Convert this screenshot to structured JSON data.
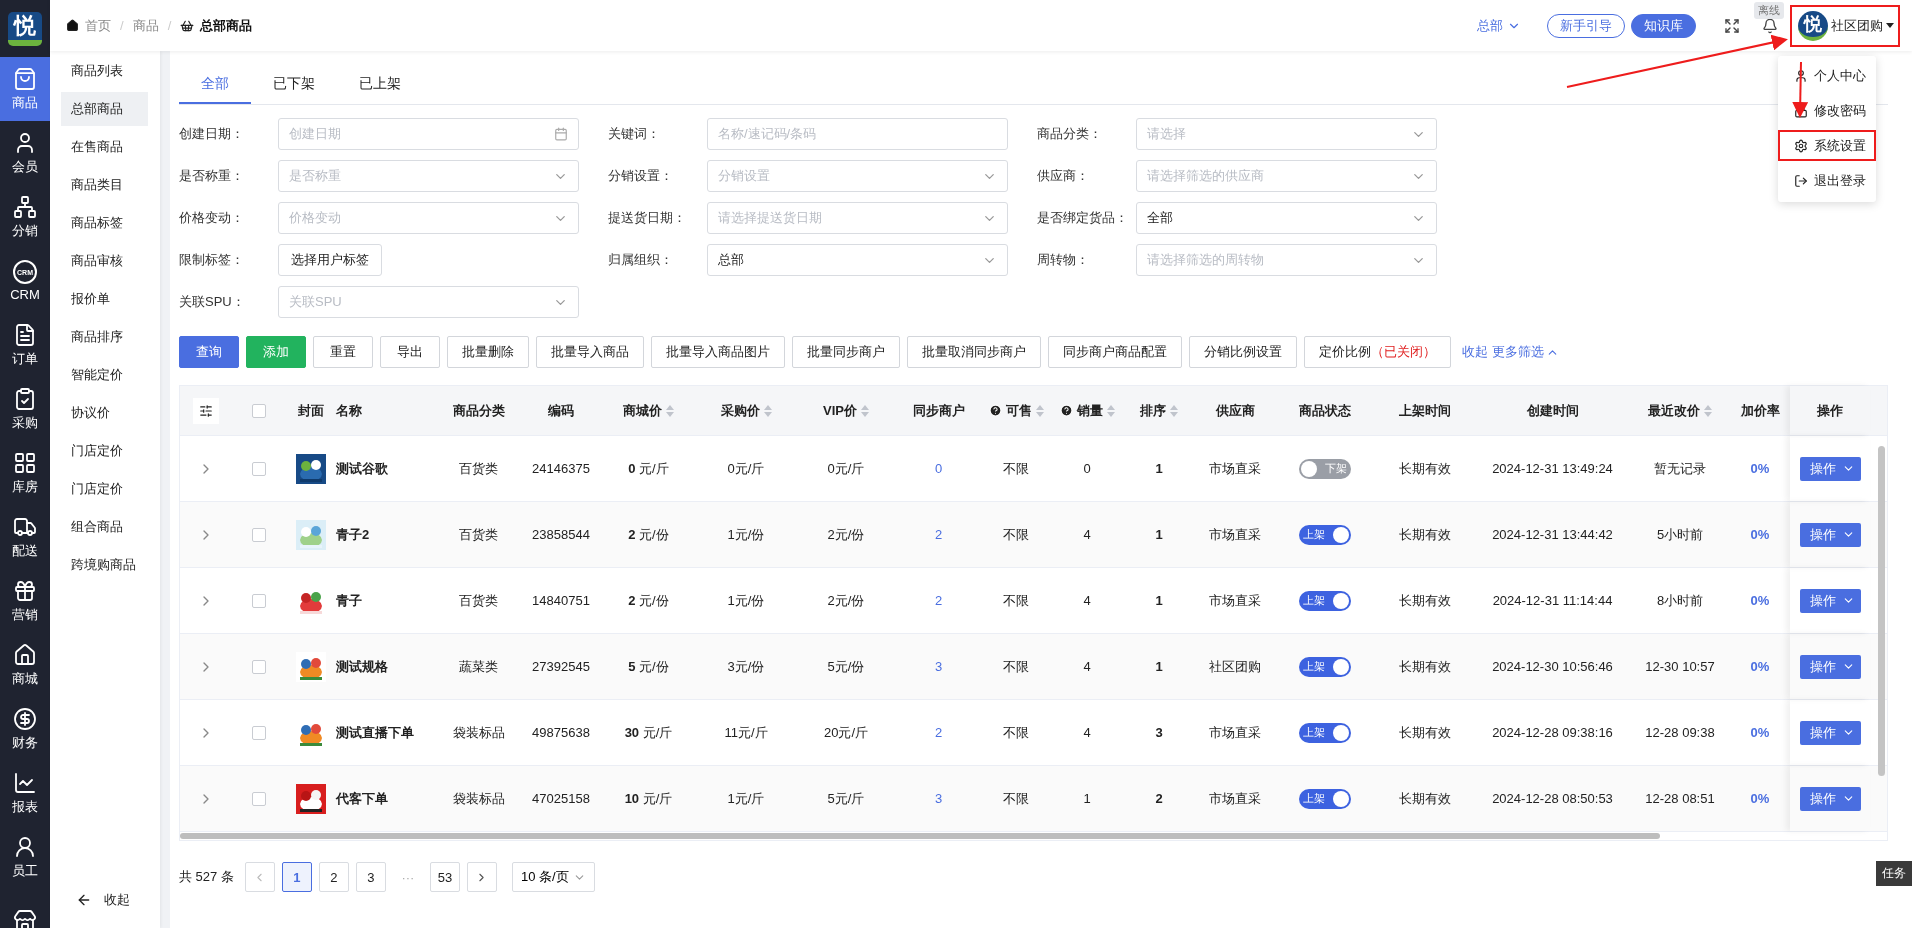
{
  "sidebar": {
    "logo": "悦",
    "items": [
      {
        "label": "商品",
        "selected": true
      },
      {
        "label": "会员",
        "selected": false
      },
      {
        "label": "分销",
        "selected": false
      },
      {
        "label": "CRM",
        "icon_text": "CRM",
        "selected": false
      },
      {
        "label": "订单",
        "selected": false
      },
      {
        "label": "采购",
        "selected": false
      },
      {
        "label": "库房",
        "selected": false
      },
      {
        "label": "配送",
        "selected": false
      },
      {
        "label": "营销",
        "selected": false
      },
      {
        "label": "商城",
        "selected": false
      },
      {
        "label": "财务",
        "selected": false
      },
      {
        "label": "报表",
        "selected": false
      },
      {
        "label": "员工",
        "selected": false
      },
      {
        "selected": false
      }
    ]
  },
  "breadcrumb": [
    {
      "label": "首页",
      "current": false
    },
    {
      "separator": "/",
      "label": "商品",
      "current": false
    },
    {
      "separator": "/",
      "label": "总部商品",
      "current": true
    }
  ],
  "header": {
    "org_switch": {
      "label": "总部",
      "expanded": false
    },
    "guide_button": "新手引导",
    "knowledge_button": "知识库",
    "status_badge": "离线",
    "user": {
      "avatar": "悦",
      "name": "社区团购",
      "highlighted": true
    }
  },
  "user_menu": [
    {
      "label": "个人中心",
      "highlighted": false
    },
    {
      "label": "修改密码",
      "highlighted": false
    },
    {
      "label": "系统设置",
      "highlighted": true
    },
    {
      "label": "退出登录",
      "highlighted": false
    }
  ],
  "submenu": {
    "items": [
      {
        "label": "商品列表",
        "selected": false
      },
      {
        "label": "总部商品",
        "selected": true
      },
      {
        "label": "在售商品",
        "selected": false
      },
      {
        "label": "商品类目",
        "selected": false
      },
      {
        "label": "商品标签",
        "selected": false
      },
      {
        "label": "商品审核",
        "selected": false
      },
      {
        "label": "报价单",
        "selected": false
      },
      {
        "label": "商品排序",
        "selected": false
      },
      {
        "label": "智能定价",
        "selected": false
      },
      {
        "label": "协议价",
        "selected": false
      },
      {
        "label": "门店定价",
        "selected": false
      },
      {
        "label": "门店定价",
        "selected": false
      },
      {
        "label": "组合商品",
        "selected": false
      },
      {
        "label": "跨境购商品",
        "selected": false
      }
    ],
    "collapse": "收起"
  },
  "tabs": [
    {
      "label": "全部",
      "selected": true
    },
    {
      "label": "已下架",
      "selected": false
    },
    {
      "label": "已上架",
      "selected": false
    }
  ],
  "filters": [
    {
      "label": "创建日期：",
      "kind": "date",
      "placeholder": "创建日期"
    },
    {
      "label": "关键词：",
      "kind": "text",
      "placeholder": "名称/速记码/条码"
    },
    {
      "label": "商品分类：",
      "kind": "select",
      "placeholder": "请选择"
    },
    {
      "label": "是否称重：",
      "kind": "select",
      "placeholder": "是否称重"
    },
    {
      "label": "分销设置：",
      "kind": "select",
      "placeholder": "分销设置"
    },
    {
      "label": "供应商：",
      "kind": "select",
      "placeholder": "请选择筛选的供应商"
    },
    {
      "label": "价格变动：",
      "kind": "select",
      "placeholder": "价格变动"
    },
    {
      "label": "提送货日期：",
      "kind": "select",
      "placeholder": "请选择提送货日期"
    },
    {
      "label": "是否绑定货品：",
      "kind": "select",
      "value": "全部"
    },
    {
      "label": "限制标签：",
      "kind": "button",
      "value": "选择用户标签"
    },
    {
      "label": "归属组织：",
      "kind": "select",
      "value": "总部"
    },
    {
      "label": "周转物：",
      "kind": "select",
      "placeholder": "请选择筛选的周转物"
    },
    {
      "label": "关联SPU：",
      "kind": "select",
      "placeholder": "关联SPU"
    }
  ],
  "actions": [
    {
      "label": "查询",
      "kind": "primary"
    },
    {
      "label": "添加",
      "kind": "success"
    },
    {
      "label": "重置",
      "kind": "default"
    },
    {
      "label": "导出",
      "kind": "default"
    },
    {
      "label": "批量删除",
      "kind": "default"
    },
    {
      "label": "批量导入商品",
      "kind": "default"
    },
    {
      "label": "批量导入商品图片",
      "kind": "default"
    },
    {
      "label": "批量同步商户",
      "kind": "default"
    },
    {
      "label": "批量取消同步商户",
      "kind": "default"
    },
    {
      "label": "同步商户商品配置",
      "kind": "default"
    },
    {
      "label": "分销比例设置",
      "kind": "default"
    },
    {
      "label": "定价比例",
      "note": "（已关闭）",
      "kind": "default"
    }
  ],
  "more_filters": "收起 更多筛选",
  "table": {
    "select_all": {
      "checked": false
    },
    "columns": [
      {
        "label": "封面",
        "sortable": false,
        "help": false
      },
      {
        "label": "名称",
        "sortable": false,
        "help": false
      },
      {
        "label": "商品分类",
        "sortable": false,
        "help": false
      },
      {
        "label": "编码",
        "sortable": false,
        "help": false
      },
      {
        "label": "商城价",
        "sortable": true,
        "help": false
      },
      {
        "label": "采购价",
        "sortable": true,
        "help": false
      },
      {
        "label": "VIP价",
        "sortable": true,
        "help": false
      },
      {
        "label": "同步商户",
        "sortable": false,
        "help": false
      },
      {
        "label": "可售",
        "sortable": true,
        "help": true
      },
      {
        "label": "销量",
        "sortable": true,
        "help": true
      },
      {
        "label": "排序",
        "sortable": true,
        "help": false
      },
      {
        "label": "供应商",
        "sortable": false,
        "help": false
      },
      {
        "label": "商品状态",
        "sortable": false,
        "help": false
      },
      {
        "label": "上架时间",
        "sortable": false,
        "help": false
      },
      {
        "label": "创建时间",
        "sortable": false,
        "help": false
      },
      {
        "label": "最近改价",
        "sortable": true,
        "help": false
      },
      {
        "label": "加价率",
        "sortable": false,
        "help": false
      },
      {
        "label": "操作",
        "sortable": false,
        "help": false
      }
    ],
    "rows": [
      {
        "expanded": false,
        "checked": false,
        "name": "测试谷歌",
        "category": "百货类",
        "code": "24146375",
        "mall_price": "**0** 元/斤",
        "purchase_price": "0元/斤",
        "vip_price": "0元/斤",
        "sync_merchants": "0",
        "sellable": "不限",
        "sales": "0",
        "sort": "1",
        "supplier": "市场直采",
        "status": {
          "label": "下架",
          "on": false
        },
        "listed": "长期有效",
        "created": "2024-12-31 13:49:24",
        "last_price_change": "暂无记录",
        "markup": "0%",
        "action": "操作"
      },
      {
        "expanded": false,
        "checked": false,
        "name": "青子2",
        "category": "百货类",
        "code": "23858544",
        "mall_price": "**2** 元/份",
        "purchase_price": "1元/份",
        "vip_price": "2元/份",
        "sync_merchants": "2",
        "sellable": "不限",
        "sales": "4",
        "sort": "1",
        "supplier": "市场直采",
        "status": {
          "label": "上架",
          "on": true
        },
        "listed": "长期有效",
        "created": "2024-12-31 13:44:42",
        "last_price_change": "5小时前",
        "markup": "0%",
        "action": "操作"
      },
      {
        "expanded": false,
        "checked": false,
        "name": "青子",
        "category": "百货类",
        "code": "14840751",
        "mall_price": "**2** 元/份",
        "purchase_price": "1元/份",
        "vip_price": "2元/份",
        "sync_merchants": "2",
        "sellable": "不限",
        "sales": "4",
        "sort": "1",
        "supplier": "市场直采",
        "status": {
          "label": "上架",
          "on": true
        },
        "listed": "长期有效",
        "created": "2024-12-31 11:14:44",
        "last_price_change": "8小时前",
        "markup": "0%",
        "action": "操作"
      },
      {
        "expanded": false,
        "checked": false,
        "name": "测试规格",
        "category": "蔬菜类",
        "code": "27392545",
        "mall_price": "**5** 元/份",
        "purchase_price": "3元/份",
        "vip_price": "5元/份",
        "sync_merchants": "3",
        "sellable": "不限",
        "sales": "4",
        "sort": "1",
        "supplier": "社区团购",
        "status": {
          "label": "上架",
          "on": true
        },
        "listed": "长期有效",
        "created": "2024-12-30 10:56:46",
        "last_price_change": "12-30 10:57",
        "markup": "0%",
        "action": "操作"
      },
      {
        "expanded": false,
        "checked": false,
        "name": "测试直播下单",
        "category": "袋装标品",
        "code": "49875638",
        "mall_price": "**30** 元/斤",
        "purchase_price": "11元/斤",
        "vip_price": "20元/斤",
        "sync_merchants": "2",
        "sellable": "不限",
        "sales": "4",
        "sort": "3",
        "supplier": "市场直采",
        "status": {
          "label": "上架",
          "on": true
        },
        "listed": "长期有效",
        "created": "2024-12-28 09:38:16",
        "last_price_change": "12-28 09:38",
        "markup": "0%",
        "action": "操作"
      },
      {
        "expanded": false,
        "checked": false,
        "name": "代客下单",
        "category": "袋装标品",
        "code": "47025158",
        "mall_price": "**10** 元/斤",
        "purchase_price": "1元/斤",
        "vip_price": "5元/斤",
        "sync_merchants": "3",
        "sellable": "不限",
        "sales": "1",
        "sort": "2",
        "supplier": "市场直采",
        "status": {
          "label": "上架",
          "on": true
        },
        "listed": "长期有效",
        "created": "2024-12-28 08:50:53",
        "last_price_change": "12-28 08:51",
        "markup": "0%",
        "action": "操作"
      }
    ]
  },
  "pagination": {
    "total": "共 527 条",
    "pages": [
      {
        "label": "1",
        "selected": true
      },
      {
        "label": "2",
        "selected": false
      },
      {
        "label": "3",
        "selected": false
      },
      {
        "label": "···",
        "kind": "ellipsis"
      },
      {
        "label": "53",
        "selected": false
      }
    ],
    "page_size": "10 条/页"
  },
  "task_tab": "任务"
}
